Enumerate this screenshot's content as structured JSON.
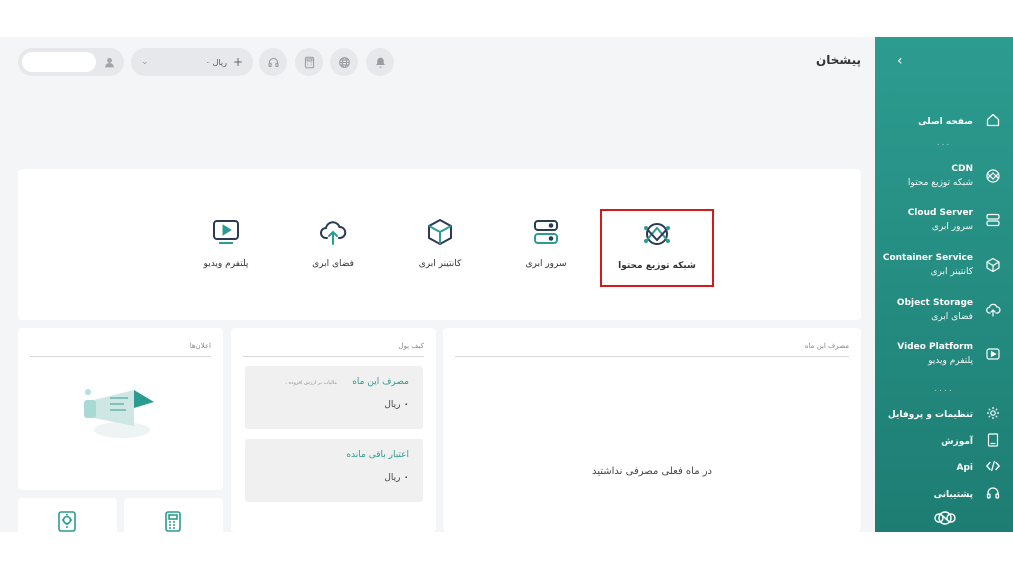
{
  "header": {
    "page_title": "پیشخان",
    "wallet_amount": "۰ ریال",
    "icons": [
      "bell-icon",
      "globe-icon",
      "calculator-icon",
      "headset-icon",
      "plus-icon",
      "user-icon",
      "chevron-down-icon"
    ]
  },
  "sidebar": {
    "collapse_icon": "chevron-left-icon",
    "items": [
      {
        "fa": "صفحه اصلی",
        "en": "",
        "icon": "home-icon"
      },
      {
        "en": "CDN",
        "fa": "شبکه توزیع محتوا",
        "icon": "cdn-icon"
      },
      {
        "en": "Cloud Server",
        "fa": "سرور ابری",
        "icon": "server-icon"
      },
      {
        "en": "Container Service",
        "fa": "کانتینر ابری",
        "icon": "cube-icon"
      },
      {
        "en": "Object Storage",
        "fa": "فضای ابری",
        "icon": "cloud-upload-icon"
      },
      {
        "en": "Video Platform",
        "fa": "پلتفرم ویدیو",
        "icon": "play-icon"
      }
    ],
    "bottom_items": [
      {
        "label": "تنظیمات و پروفایل",
        "icon": "gear-icon"
      },
      {
        "label": "آموزش",
        "icon": "book-icon"
      },
      {
        "label": "Api",
        "icon": "code-icon"
      },
      {
        "label": "پشتیبانی",
        "icon": "headset-icon"
      }
    ]
  },
  "services": [
    {
      "label": "شبکه توزیع محتوا",
      "icon": "cdn-icon",
      "selected": true
    },
    {
      "label": "سرور ابری",
      "icon": "server-icon"
    },
    {
      "label": "کانتینر ابری",
      "icon": "cube-icon"
    },
    {
      "label": "فضای ابری",
      "icon": "cloud-upload-icon"
    },
    {
      "label": "پلتفرم ویدیو",
      "icon": "play-icon"
    }
  ],
  "usage_panel": {
    "title": "مصرف این ماه",
    "empty_text": "در ماه فعلی مصرفی نداشتید"
  },
  "wallet_panel": {
    "title": "کیف پول",
    "this_month_title": "مصرف این ماه",
    "this_month_note": "، مالیات بر ارزش افزوده",
    "this_month_value": "ریال",
    "this_month_zero": "۰",
    "remaining_title": "اعتبار باقی مانده",
    "remaining_value": "ریال",
    "remaining_zero": "۰"
  },
  "announcements_panel": {
    "title": "اعلان‌ها"
  },
  "colors": {
    "accent": "#2d9c90",
    "highlight": "#d21a1a"
  }
}
